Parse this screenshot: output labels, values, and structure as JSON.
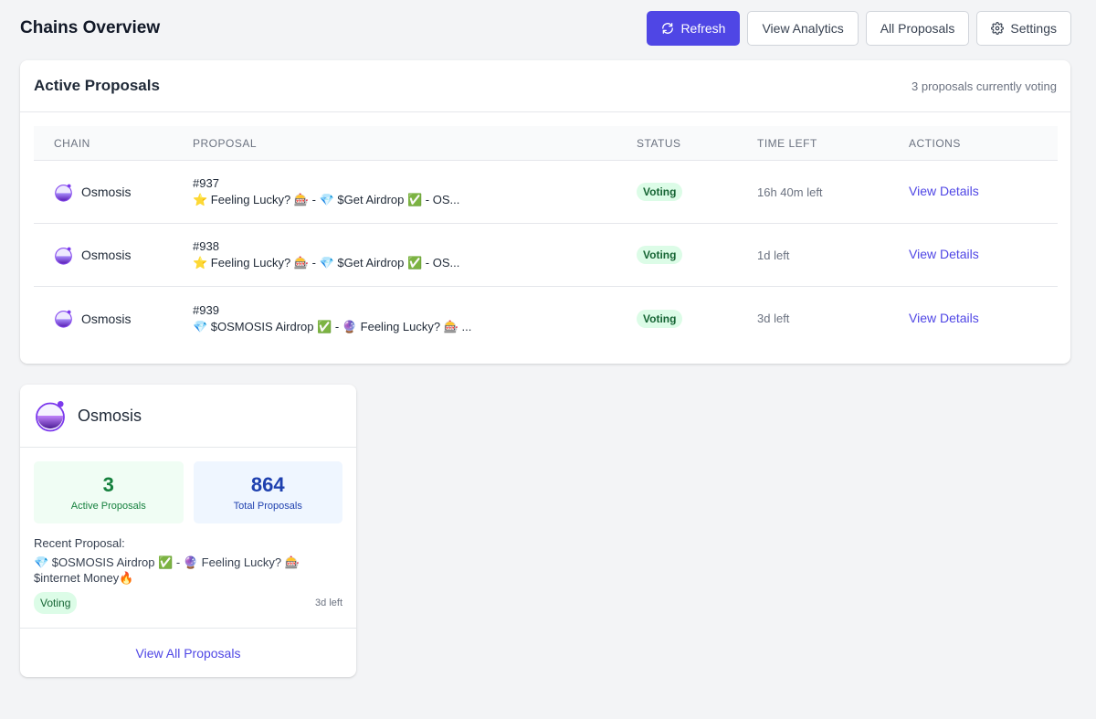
{
  "header": {
    "title": "Chains Overview",
    "buttons": {
      "refresh": "Refresh",
      "analytics": "View Analytics",
      "all_proposals": "All Proposals",
      "settings": "Settings"
    }
  },
  "active": {
    "title": "Active Proposals",
    "count_text": "3 proposals currently voting",
    "columns": [
      "Chain",
      "Proposal",
      "Status",
      "Time Left",
      "Actions"
    ],
    "rows": [
      {
        "chain": "Osmosis",
        "id": "#937",
        "text": "⭐ Feeling Lucky? 🎰 - 💎 $Get Airdrop ✅ - OS...",
        "status": "Voting",
        "time": "16h 40m left",
        "action": "View Details"
      },
      {
        "chain": "Osmosis",
        "id": "#938",
        "text": "⭐ Feeling Lucky? 🎰 - 💎 $Get Airdrop ✅ - OS...",
        "status": "Voting",
        "time": "1d left",
        "action": "View Details"
      },
      {
        "chain": "Osmosis",
        "id": "#939",
        "text": "💎 $OSMOSIS Airdrop ✅ - 🔮 Feeling Lucky? 🎰 ...",
        "status": "Voting",
        "time": "3d left",
        "action": "View Details"
      }
    ]
  },
  "chain_card": {
    "name": "Osmosis",
    "active_count": "3",
    "active_label": "Active Proposals",
    "total_count": "864",
    "total_label": "Total Proposals",
    "recent_label": "Recent Proposal:",
    "recent_text": "💎 $OSMOSIS Airdrop ✅ - 🔮 Feeling Lucky? 🎰 $internet Money🔥",
    "status": "Voting",
    "time": "3d left",
    "view_all": "View All Proposals"
  },
  "colors": {
    "primary": "#4f46e5",
    "voting_bg": "#dcfce7",
    "voting_text": "#166534",
    "osmosis_purple": "#7c3aed"
  },
  "icons": {
    "refresh": "refresh-icon",
    "settings": "gear-icon",
    "chain": "osmosis-logo-icon"
  }
}
